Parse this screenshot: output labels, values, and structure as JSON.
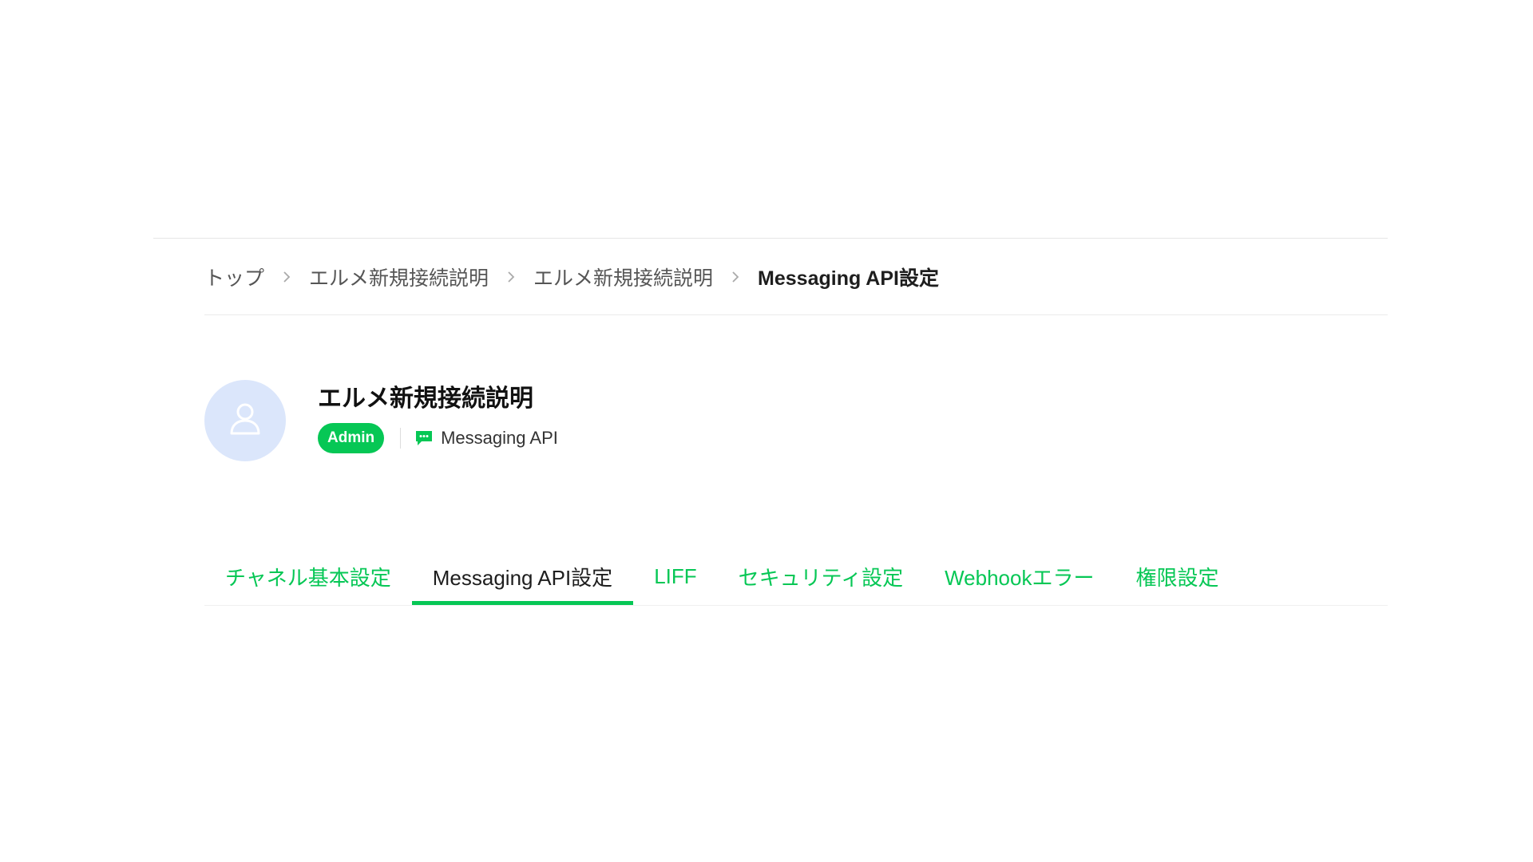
{
  "breadcrumb": {
    "items": [
      "トップ",
      "エルメ新規接続説明",
      "エルメ新規接続説明"
    ],
    "current": "Messaging API設定",
    "separator": "›"
  },
  "channel": {
    "name": "エルメ新規接続説明",
    "role_badge": "Admin",
    "type_label": "Messaging API",
    "avatar_icon": "user-outline-icon",
    "type_icon": "chat-bubble-icon"
  },
  "tabs": [
    {
      "label": "チャネル基本設定",
      "active": false
    },
    {
      "label": "Messaging API設定",
      "active": true
    },
    {
      "label": "LIFF",
      "active": false
    },
    {
      "label": "セキュリティ設定",
      "active": false
    },
    {
      "label": "Webhookエラー",
      "active": false
    },
    {
      "label": "権限設定",
      "active": false
    }
  ],
  "colors": {
    "accent": "#06c755",
    "avatar_bg": "#dbe6fb",
    "text": "#1e1e1e"
  }
}
